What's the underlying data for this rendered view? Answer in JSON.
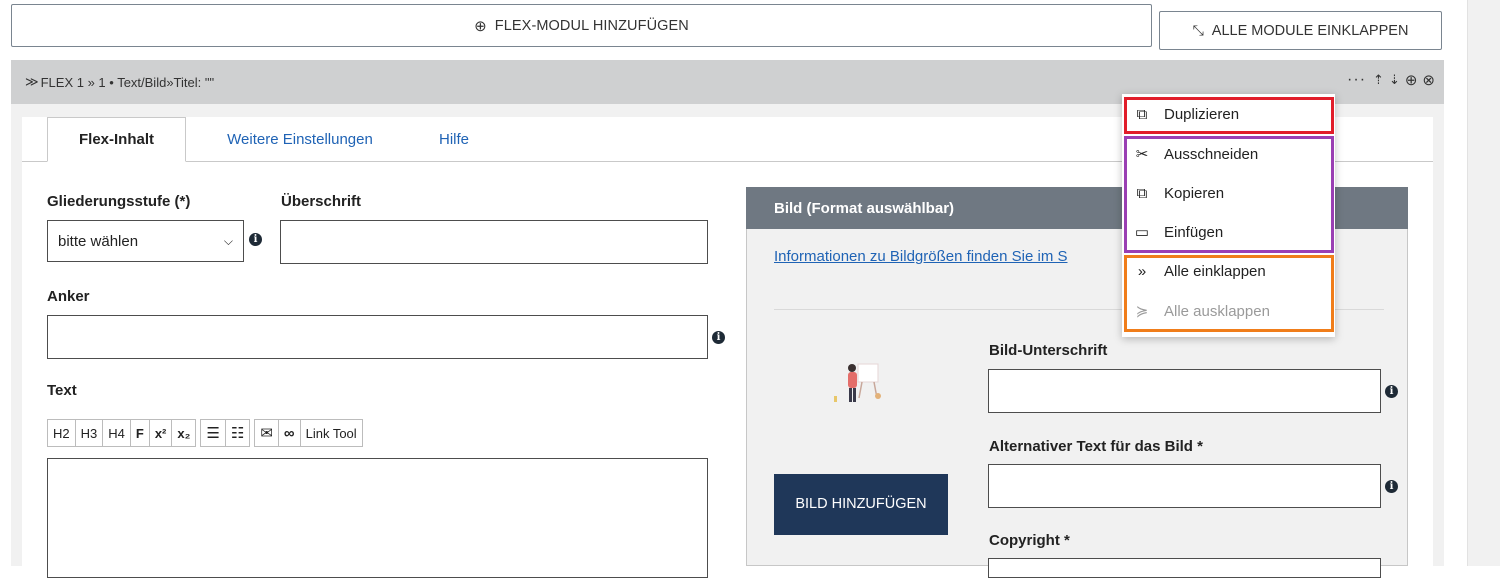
{
  "toolbar": {
    "add_module_label": "FLEX-MODUL HINZUFÜGEN",
    "collapse_all_label": "ALLE MODULE EINKLAPPEN"
  },
  "module": {
    "header_title": "FLEX 1 » 1 • Text/Bild»Titel: \"\"",
    "actions": [
      "more",
      "move-up",
      "move-down",
      "add",
      "remove"
    ]
  },
  "tabs": [
    {
      "label": "Flex-Inhalt"
    },
    {
      "label": "Weitere Einstellungen"
    },
    {
      "label": "Hilfe"
    }
  ],
  "form": {
    "gliederung_label": "Gliederungsstufe (*)",
    "gliederung_value": "bitte wählen",
    "ueberschrift_label": "Überschrift",
    "anker_label": "Anker",
    "text_label": "Text",
    "editor_buttons": {
      "h2": "H2",
      "h3": "H3",
      "h4": "H4",
      "bold": "F",
      "sup": "x²",
      "sub": "x₂",
      "link_tool": "Link Tool"
    }
  },
  "image_panel": {
    "title": "Bild (Format auswählbar)",
    "info_link": "Informationen zu Bildgrößen finden Sie im S",
    "caption_label": "Bild-Unterschrift",
    "alt_label": "Alternativer Text für das Bild *",
    "copyright_label": "Copyright *",
    "add_image_label": "BILD HINZUFÜGEN"
  },
  "context_menu": {
    "items": [
      {
        "label": "Duplizieren",
        "icon": "duplicate-icon"
      },
      {
        "label": "Ausschneiden",
        "icon": "scissors-icon"
      },
      {
        "label": "Kopieren",
        "icon": "copy-icon"
      },
      {
        "label": "Einfügen",
        "icon": "paste-icon"
      },
      {
        "label": "Alle einklappen",
        "icon": "double-chevron-right-icon"
      },
      {
        "label": "Alle ausklappen",
        "icon": "double-chevron-down-icon"
      }
    ],
    "highlight_colors": {
      "red": "#e11d2a",
      "purple": "#9a3fb3",
      "orange": "#f07d1a"
    }
  }
}
